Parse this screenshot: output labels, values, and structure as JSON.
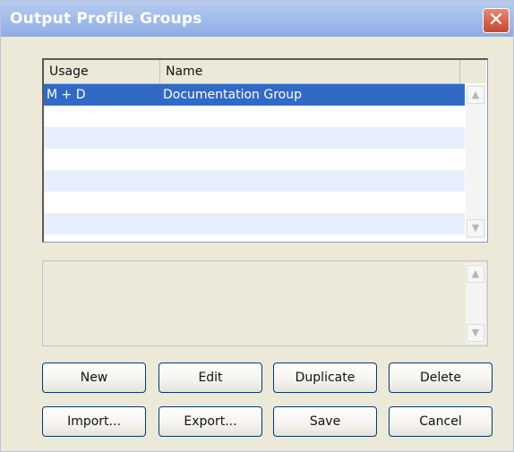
{
  "window": {
    "title": "Output Profile Groups",
    "close_glyph": "✕"
  },
  "list": {
    "columns": [
      "Usage",
      "Name"
    ],
    "rows": [
      {
        "usage": "M + D",
        "name": "Documentation Group",
        "selected": true
      }
    ],
    "scroll_up_glyph": "▲",
    "scroll_down_glyph": "▼"
  },
  "description": {
    "text": "",
    "scroll_up_glyph": "▲",
    "scroll_down_glyph": "▼"
  },
  "buttons": {
    "new": "New",
    "edit": "Edit",
    "duplicate": "Duplicate",
    "delete": "Delete",
    "import": "Import...",
    "export": "Export...",
    "save": "Save",
    "cancel": "Cancel"
  },
  "colors": {
    "selection": "#316ac5",
    "alt_row": "#e6eefb",
    "dialog_bg": "#ece9d8",
    "titlebar": "#9bb7ea"
  }
}
